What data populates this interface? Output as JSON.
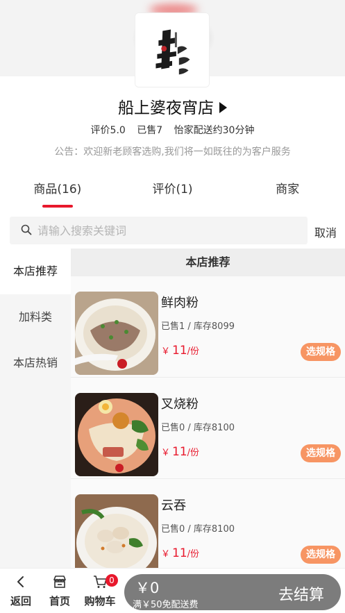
{
  "store": {
    "name": "船上婆夜宵店",
    "rating": "评价5.0",
    "sold": "已售7",
    "delivery": "怡家配送约30分钟",
    "notice": "公告：欢迎新老顾客选购,我们将一如既往的为客户服务"
  },
  "tabs": [
    {
      "label": "商品(16)",
      "active": true
    },
    {
      "label": "评价(1)",
      "active": false
    },
    {
      "label": "商家",
      "active": false
    }
  ],
  "search": {
    "placeholder": "请输入搜索关键词",
    "cancel": "取消"
  },
  "categories": [
    {
      "label": "本店推荐",
      "active": true
    },
    {
      "label": "加料类",
      "active": false
    },
    {
      "label": "本店热销",
      "active": false
    }
  ],
  "section_title": "本店推荐",
  "products": [
    {
      "name": "鲜肉粉",
      "stats": "已售1 / 库存8099",
      "currency": "￥",
      "price": "11",
      "unit": "/份",
      "button": "选规格"
    },
    {
      "name": "叉烧粉",
      "stats": "已售0 / 库存8100",
      "currency": "￥",
      "price": "11",
      "unit": "/份",
      "button": "选规格"
    },
    {
      "name": "云吞",
      "stats": "已售0 / 库存8100",
      "currency": "￥",
      "price": "11",
      "unit": "/份",
      "button": "选规格"
    }
  ],
  "bottom": {
    "back": "返回",
    "home": "首页",
    "cart": "购物车",
    "cart_count": "0",
    "total": "￥0",
    "free_delivery": "满￥50免配送费",
    "checkout": "去结算"
  },
  "colors": {
    "accent": "#e8182c",
    "spec_button": "#f79563",
    "checkout_bar": "#7c7c7c"
  },
  "icons": [
    "search-icon",
    "play-triangle-icon",
    "back-arrow-icon",
    "store-icon",
    "cart-icon"
  ]
}
